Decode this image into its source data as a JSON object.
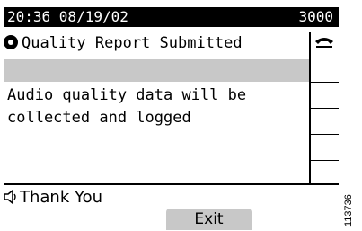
{
  "status_bar": {
    "datetime": "20:36 08/19/02",
    "extension": "3000"
  },
  "title": {
    "text": "Quality Report Submitted",
    "icon": "quality-icon"
  },
  "message": {
    "text": "Audio quality data will be collected and logged"
  },
  "right_panel": {
    "line_icon": "handset-icon"
  },
  "prompt": {
    "text": "Thank You",
    "icon": "speaker-icon"
  },
  "softkeys": [
    {
      "label": "Exit"
    }
  ],
  "figure_id": "113736"
}
